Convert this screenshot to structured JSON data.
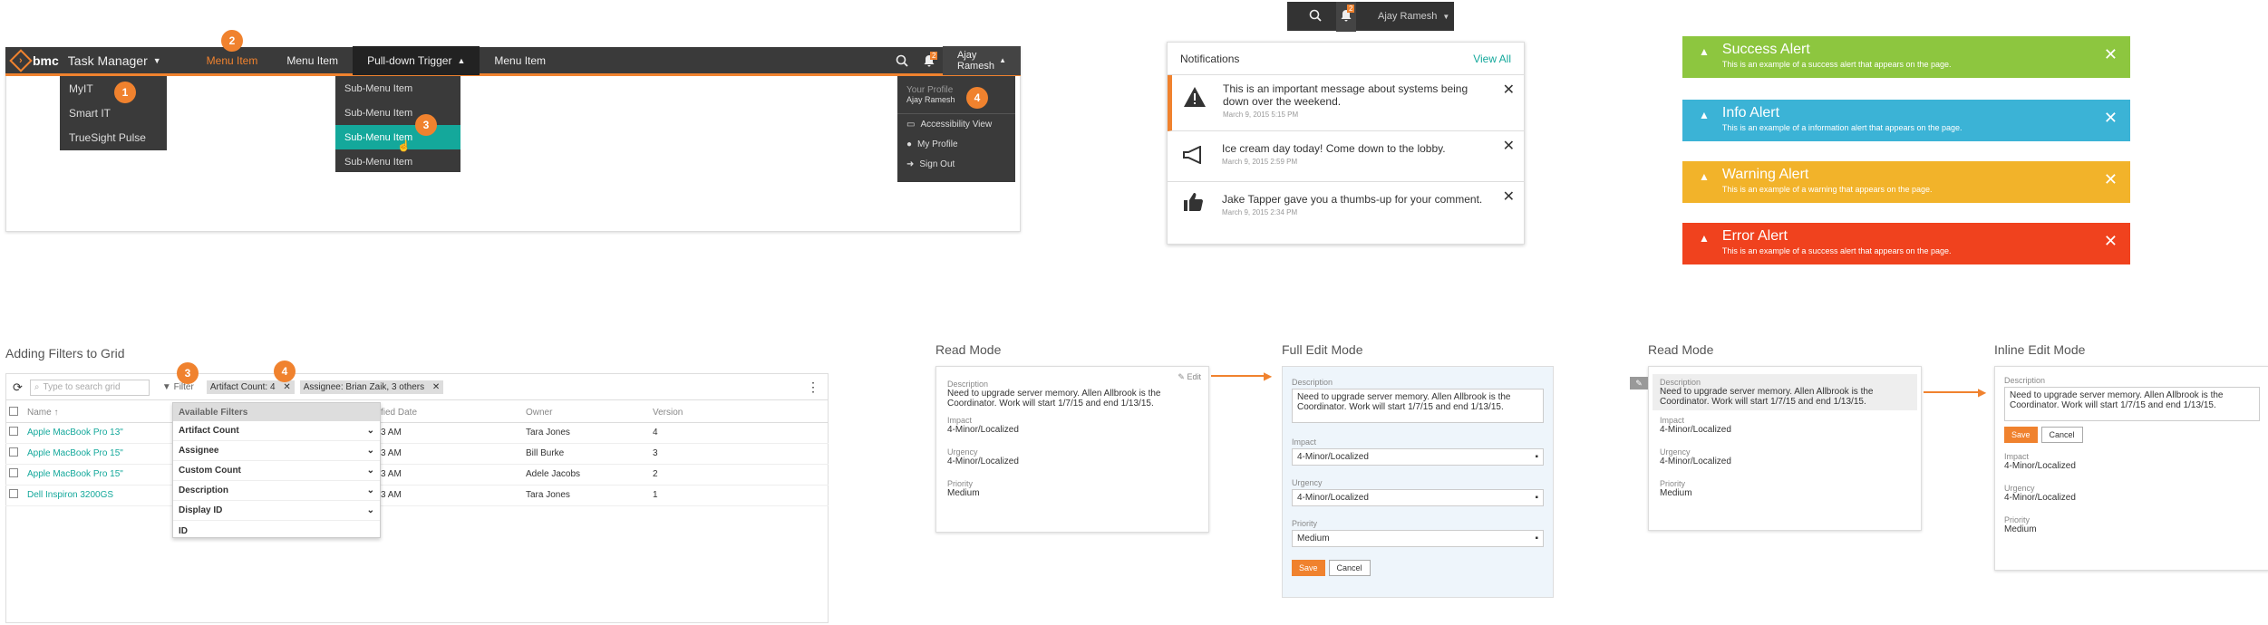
{
  "nav": {
    "brand": "bmc",
    "app": "Task Manager",
    "items": [
      "Menu Item",
      "Menu Item",
      "Pull-down Trigger",
      "Menu Item"
    ],
    "user": "Ajay Ramesh",
    "notif_count": "2",
    "app_menu": [
      "MyIT",
      "Smart IT",
      "TrueSight Pulse"
    ],
    "sub_menu": [
      "Sub-Menu Item",
      "Sub-Menu Item",
      "Sub-Menu Item",
      "Sub-Menu Item"
    ],
    "profile": {
      "title": "Your Profile",
      "name": "Ajay Ramesh",
      "items": [
        "Accessibility View",
        "My Profile",
        "Sign Out"
      ]
    },
    "badges": [
      "1",
      "2",
      "3",
      "4"
    ]
  },
  "notifications": {
    "user": "Ajay Ramesh",
    "count": "2",
    "header": "Notifications",
    "view_all": "View All",
    "items": [
      {
        "text": "This is an important message about systems being down over the weekend.",
        "date": "March 9, 2015 5:15 PM",
        "icon": "warning-icon"
      },
      {
        "text": "Ice cream day today! Come down to the lobby.",
        "date": "March 9, 2015 2:59 PM",
        "icon": "megaphone-icon"
      },
      {
        "text": "Jake Tapper gave you a thumbs-up for your comment.",
        "date": "March 9, 2015 2:34 PM",
        "icon": "thumbs-up-icon"
      }
    ]
  },
  "alerts": [
    {
      "title": "Success Alert",
      "msg": "This is an example of a success alert that appears on the page.",
      "color": "#8dc63f"
    },
    {
      "title": "Info Alert",
      "msg": "This is an example of a information alert that appears on the page.",
      "color": "#3bb3d6"
    },
    {
      "title": "Warning Alert",
      "msg": "This is an example of a warning that appears on the page.",
      "color": "#f2b32a"
    },
    {
      "title": "Error Alert",
      "msg": "This is an example of a success alert that appears on the page.",
      "color": "#f0421e"
    }
  ],
  "grid": {
    "title": "Adding Filters to Grid",
    "search_placeholder": "Type to search grid",
    "filter": "Filter",
    "chip1": "Artifact Count: 4",
    "chip2": "Assignee: Brian Zaik, 3 others",
    "badge3": "3",
    "badge4": "4",
    "columns": [
      "Name",
      "fied Date",
      "Owner",
      "Version"
    ],
    "rows": [
      [
        "Apple MacBook Pro 13\"",
        "3 AM",
        "Tara Jones",
        "4"
      ],
      [
        "Apple MacBook Pro 15\"",
        "3 AM",
        "Bill Burke",
        "3"
      ],
      [
        "Apple MacBook Pro 15\"",
        "3 AM",
        "Adele Jacobs",
        "2"
      ],
      [
        "Dell Inspiron 3200GS",
        "3 AM",
        "Tara Jones",
        "1"
      ]
    ],
    "filters_title": "Available Filters",
    "filters": [
      "Artifact Count",
      "Assignee",
      "Custom Count",
      "Description",
      "Display ID",
      "ID"
    ]
  },
  "edit": {
    "read1": "Read Mode",
    "full": "Full Edit Mode",
    "read2": "Read Mode",
    "inline": "Inline Edit Mode",
    "desc_label": "Description",
    "desc": "Need to upgrade server memory. Allen Allbrook is the Coordinator. Work will start 1/7/15 and end 1/13/15.",
    "impact_label": "Impact",
    "impact": "4-Minor/Localized",
    "urgency_label": "Urgency",
    "urgency": "4-Minor/Localized",
    "priority_label": "Priority",
    "priority": "Medium",
    "edit": "Edit",
    "save": "Save",
    "cancel": "Cancel"
  }
}
